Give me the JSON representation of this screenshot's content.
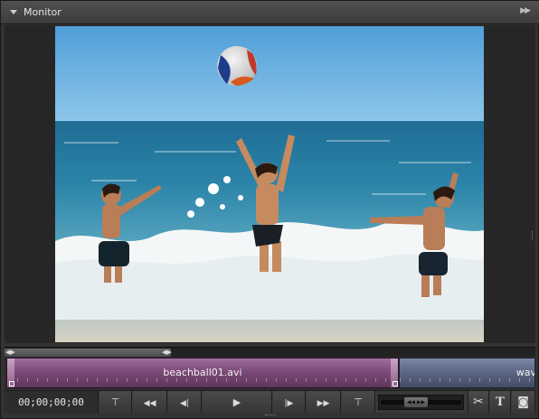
{
  "panel": {
    "title": "Monitor",
    "collapse_icon": "triangle-down-icon",
    "menu_icon": "double-chevron-right-icon"
  },
  "timeline": {
    "clips": [
      {
        "name": "beachball01.avi",
        "color": "#7c4a78"
      },
      {
        "name": "wav",
        "color": "#5a6583"
      }
    ]
  },
  "transport": {
    "timecode": "00;00;00;00",
    "buttons": [
      {
        "id": "set-in",
        "icon": "set-in-point-icon",
        "glyph": "⊤"
      },
      {
        "id": "rewind",
        "icon": "rewind-icon",
        "glyph": "◀◀"
      },
      {
        "id": "step-back",
        "icon": "step-back-icon",
        "glyph": "◀|"
      },
      {
        "id": "play",
        "icon": "play-icon",
        "glyph": "▶"
      },
      {
        "id": "step-forward",
        "icon": "step-forward-icon",
        "glyph": "|▶"
      },
      {
        "id": "fast-forward",
        "icon": "fast-forward-icon",
        "glyph": "▶▶"
      },
      {
        "id": "set-out",
        "icon": "set-out-point-icon",
        "glyph": "⊤"
      }
    ],
    "tools": [
      {
        "id": "split",
        "icon": "scissors-icon",
        "glyph": "✂"
      },
      {
        "id": "title",
        "icon": "text-tool-icon",
        "glyph": "T"
      },
      {
        "id": "snapshot",
        "icon": "camera-icon",
        "glyph": "◙"
      }
    ]
  }
}
